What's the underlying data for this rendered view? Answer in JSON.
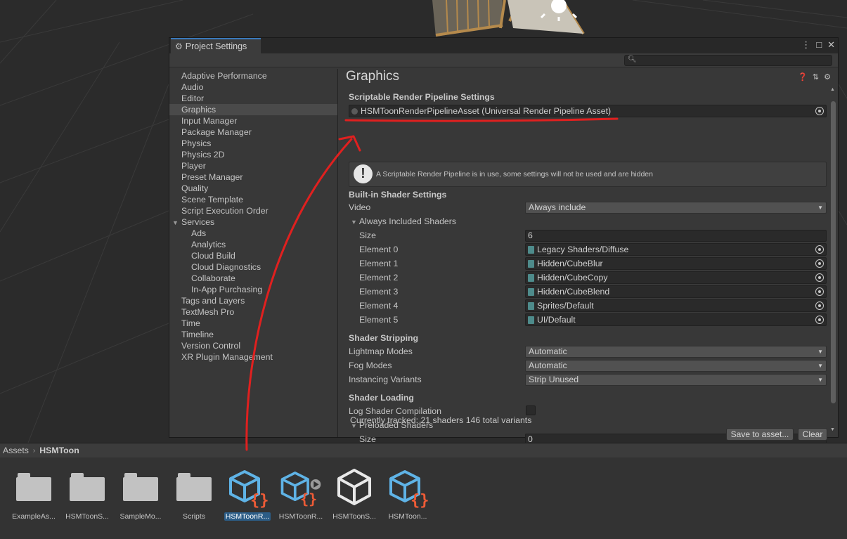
{
  "window": {
    "tab_title": "Project Settings",
    "controls": [
      "⋮",
      "□",
      "✕"
    ],
    "search_placeholder": ""
  },
  "sidebar": {
    "items": [
      {
        "label": "Adaptive Performance"
      },
      {
        "label": "Audio"
      },
      {
        "label": "Editor"
      },
      {
        "label": "Graphics",
        "selected": true
      },
      {
        "label": "Input Manager"
      },
      {
        "label": "Package Manager"
      },
      {
        "label": "Physics"
      },
      {
        "label": "Physics 2D"
      },
      {
        "label": "Player"
      },
      {
        "label": "Preset Manager"
      },
      {
        "label": "Quality"
      },
      {
        "label": "Scene Template"
      },
      {
        "label": "Script Execution Order"
      },
      {
        "label": "Services",
        "expanded": true
      },
      {
        "label": "Ads",
        "sub": true
      },
      {
        "label": "Analytics",
        "sub": true
      },
      {
        "label": "Cloud Build",
        "sub": true
      },
      {
        "label": "Cloud Diagnostics",
        "sub": true
      },
      {
        "label": "Collaborate",
        "sub": true
      },
      {
        "label": "In-App Purchasing",
        "sub": true
      },
      {
        "label": "Tags and Layers"
      },
      {
        "label": "TextMesh Pro"
      },
      {
        "label": "Time"
      },
      {
        "label": "Timeline"
      },
      {
        "label": "Version Control"
      },
      {
        "label": "XR Plugin Management"
      }
    ]
  },
  "graphics": {
    "title": "Graphics",
    "srp_section": "Scriptable Render Pipeline Settings",
    "srp_asset": "HSMToonRenderPipelineAsset (Universal Render Pipeline Asset)",
    "srp_warning": "A Scriptable Render Pipeline is in use, some settings will not be used and are hidden",
    "builtin_section": "Built-in Shader Settings",
    "video_label": "Video",
    "video_value": "Always include",
    "always_included_label": "Always Included Shaders",
    "size_label": "Size",
    "size_value": "6",
    "elements": [
      {
        "label": "Element 0",
        "value": "Legacy Shaders/Diffuse"
      },
      {
        "label": "Element 1",
        "value": "Hidden/CubeBlur"
      },
      {
        "label": "Element 2",
        "value": "Hidden/CubeCopy"
      },
      {
        "label": "Element 3",
        "value": "Hidden/CubeBlend"
      },
      {
        "label": "Element 4",
        "value": "Sprites/Default"
      },
      {
        "label": "Element 5",
        "value": "UI/Default"
      }
    ],
    "stripping_section": "Shader Stripping",
    "lightmap_label": "Lightmap Modes",
    "lightmap_value": "Automatic",
    "fog_label": "Fog Modes",
    "fog_value": "Automatic",
    "instancing_label": "Instancing Variants",
    "instancing_value": "Strip Unused",
    "loading_section": "Shader Loading",
    "log_label": "Log Shader Compilation",
    "preloaded_label": "Preloaded Shaders",
    "preloaded_size_label": "Size",
    "preloaded_size_value": "0",
    "tracked_text": "Currently tracked: 21 shaders 146 total variants",
    "save_button": "Save to asset...",
    "clear_button": "Clear"
  },
  "project": {
    "breadcrumb_root": "Assets",
    "breadcrumb_current": "HSMToon",
    "assets": [
      {
        "name": "ExampleAs...",
        "icon": "folder-icon"
      },
      {
        "name": "HSMToonS...",
        "icon": "folder-icon"
      },
      {
        "name": "SampleMo...",
        "icon": "folder-icon"
      },
      {
        "name": "Scripts",
        "icon": "folder-icon"
      },
      {
        "name": "HSMToonR...",
        "icon": "shader-asset-icon",
        "selected": true
      },
      {
        "name": "HSMToonR...",
        "icon": "shader-asset-play-icon"
      },
      {
        "name": "HSMToonS...",
        "icon": "unity-logo-icon"
      },
      {
        "name": "HSMToon...",
        "icon": "shader-asset-icon"
      }
    ]
  },
  "colors": {
    "accent": "#3a79bb",
    "annotation": "#e0201f",
    "shader_icon_blue": "#5fb3e6",
    "shader_icon_orange": "#ee5b36"
  }
}
